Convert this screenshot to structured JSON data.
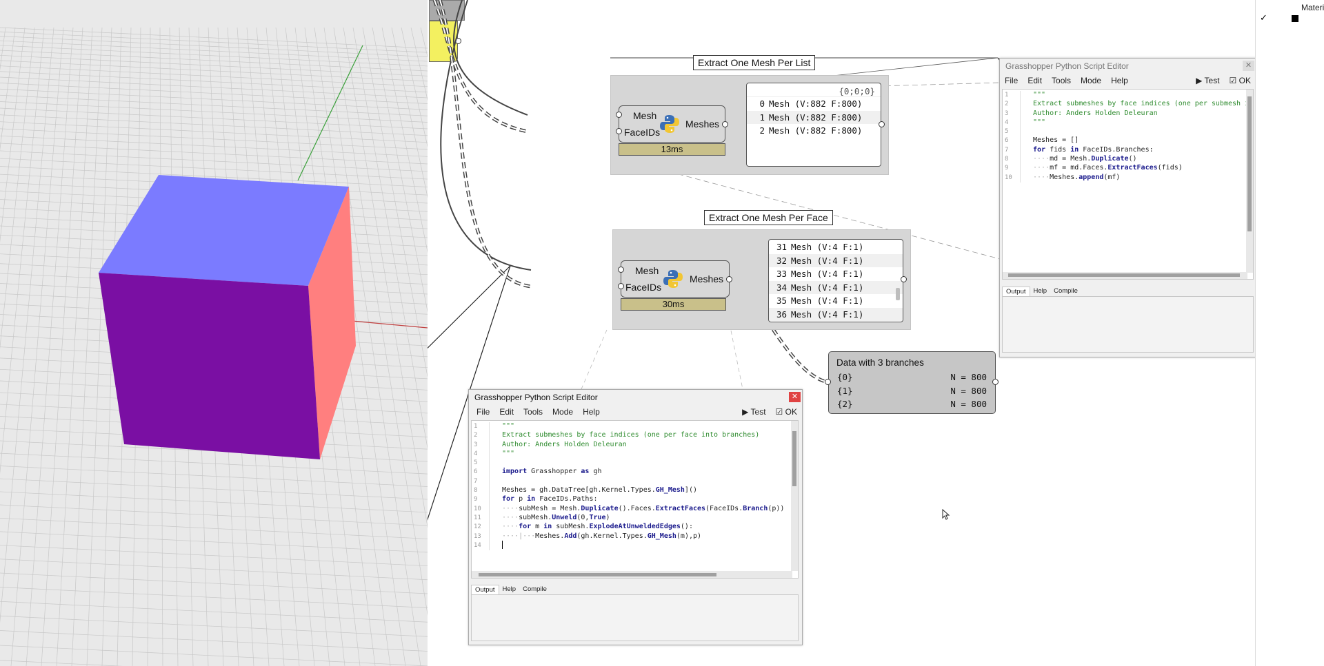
{
  "viewport": {
    "cube_colors": {
      "top": "#7b7bff",
      "front": "#7a0fa3",
      "right": "#ff7f7f"
    },
    "grid_color": "#c8c8c8",
    "axis_y_color": "#3aa03a",
    "axis_x_color": "#c04040"
  },
  "groups": {
    "per_list": {
      "label": "Extract One Mesh Per List"
    },
    "per_face": {
      "label": "Extract One Mesh Per Face"
    }
  },
  "comp_list": {
    "in1": "Mesh",
    "in2": "FaceIDs",
    "out": "Meshes",
    "time": "13ms"
  },
  "comp_face": {
    "in1": "Mesh",
    "in2": "FaceIDs",
    "out": "Meshes",
    "time": "30ms"
  },
  "panel_list": {
    "path": "{0;0;0}",
    "rows": [
      {
        "idx": "0",
        "text": "Mesh (V:882  F:800)"
      },
      {
        "idx": "1",
        "text": "Mesh (V:882  F:800)"
      },
      {
        "idx": "2",
        "text": "Mesh (V:882  F:800)"
      }
    ]
  },
  "panel_face": {
    "rows": [
      {
        "idx": "31",
        "text": "Mesh (V:4  F:1)"
      },
      {
        "idx": "32",
        "text": "Mesh (V:4  F:1)"
      },
      {
        "idx": "33",
        "text": "Mesh (V:4  F:1)"
      },
      {
        "idx": "34",
        "text": "Mesh (V:4  F:1)"
      },
      {
        "idx": "35",
        "text": "Mesh (V:4  F:1)"
      },
      {
        "idx": "36",
        "text": "Mesh (V:4  F:1)"
      }
    ]
  },
  "branches": {
    "title": "Data with 3 branches",
    "rows": [
      {
        "path": "{0}",
        "n": "N = 800"
      },
      {
        "path": "{1}",
        "n": "N = 800"
      },
      {
        "path": "{2}",
        "n": "N = 800"
      }
    ]
  },
  "editor_top": {
    "title": "Grasshopper Python Script Editor",
    "menu": [
      "File",
      "Edit",
      "Tools",
      "Mode",
      "Help"
    ],
    "test": "Test",
    "ok": "OK",
    "lines": [
      "\"\"\"",
      "Extract submeshes by face indices (one per submesh into list)",
      "Author: Anders Holden Deleuran",
      "\"\"\"",
      "",
      "Meshes = []",
      "for fids in FaceIDs.Branches:",
      "····md = Mesh.Duplicate()",
      "····mf = md.Faces.ExtractFaces(fids)",
      "····Meshes.append(mf)"
    ],
    "tabs": [
      "Output",
      "Help",
      "Compile"
    ]
  },
  "editor_bottom": {
    "title": "Grasshopper Python Script Editor",
    "menu": [
      "File",
      "Edit",
      "Tools",
      "Mode",
      "Help"
    ],
    "test": "Test",
    "ok": "OK",
    "lines": [
      "\"\"\"",
      "Extract submeshes by face indices (one per face into branches)",
      "Author: Anders Holden Deleuran",
      "\"\"\"",
      "",
      "import Grasshopper as gh",
      "",
      "Meshes = gh.DataTree[gh.Kernel.Types.GH_Mesh]()",
      "for p in FaceIDs.Paths:",
      "····subMesh = Mesh.Duplicate().Faces.ExtractFaces(FaceIDs.Branch(p))",
      "····subMesh.Unweld(0,True)",
      "····for m in subMesh.ExplodeAtUnweldedEdges():",
      "····|···Meshes.Add(gh.Kernel.Types.GH_Mesh(m),p)",
      ""
    ],
    "tabs": [
      "Output",
      "Help",
      "Compile"
    ]
  },
  "right_strip": {
    "label": "Materi"
  }
}
